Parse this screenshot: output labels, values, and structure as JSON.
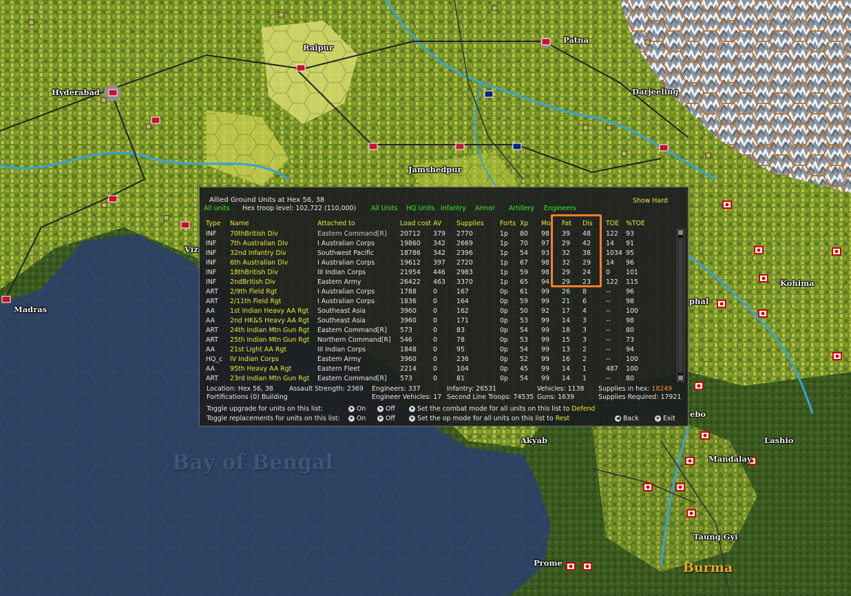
{
  "map": {
    "cities": [
      {
        "name": "Raipur",
        "key": "raipur"
      },
      {
        "name": "Patna",
        "key": "patna"
      },
      {
        "name": "Hyderabad",
        "key": "hyderabad"
      },
      {
        "name": "Darjeeling",
        "key": "darjeeling"
      },
      {
        "name": "Jamshedpur",
        "key": "jamshedpur"
      },
      {
        "name": "Madras",
        "key": "madras"
      },
      {
        "name": "Kohima",
        "key": "kohima"
      },
      {
        "name": "Akyab",
        "key": "akyab"
      },
      {
        "name": "Lashio",
        "key": "lashio"
      },
      {
        "name": "Mandalay",
        "key": "mandalay"
      },
      {
        "name": "Taung Gyi",
        "key": "taunggyi"
      },
      {
        "name": "Prome",
        "key": "prome"
      },
      {
        "name": "Viza",
        "key": "viza"
      },
      {
        "name": "phal",
        "key": "phal"
      },
      {
        "name": "ebo",
        "key": "ebo"
      }
    ],
    "sea_label": "Bay of Bengal",
    "region_label": "Burma"
  },
  "panel": {
    "title": "Allied Ground Units at Hex 56, 38",
    "filter_all": "All units",
    "troop_level": "Hex troop level: 102,722  (110,000)",
    "show_hard": "Show Hard",
    "filters": [
      "All Units",
      "HQ Units",
      "Infantry",
      "Armor",
      "Artillery",
      "Engineers"
    ],
    "headers": {
      "type": "Type",
      "name": "Name",
      "attached": "Attached to",
      "load": "Load cost",
      "av": "AV",
      "supplies": "Supplies",
      "forts": "Forts",
      "xp": "Xp",
      "mo": "Mo",
      "fat": "Fat",
      "dis": "Dis",
      "toe": "TOE",
      "ptoe": "%TOE"
    },
    "rows": [
      {
        "type": "INF",
        "name": "70thBritish Div",
        "attached": "Eastern Command[R]",
        "load": "20712",
        "av": "379",
        "supplies": "2770",
        "forts": "1p",
        "xp": "80",
        "mo": "98",
        "fat": "39",
        "dis": "48",
        "toe": "122",
        "ptoe": "93"
      },
      {
        "type": "INF",
        "name": "7th Australian Div",
        "attached": "I Australian Corps",
        "load": "19860",
        "av": "342",
        "supplies": "2669",
        "forts": "1p",
        "xp": "70",
        "mo": "97",
        "fat": "29",
        "dis": "42",
        "toe": "14",
        "ptoe": "91"
      },
      {
        "type": "INF",
        "name": "32nd Infantry Div",
        "attached": "Southwest Pacific",
        "load": "18786",
        "av": "342",
        "supplies": "2396",
        "forts": "1p",
        "xp": "54",
        "mo": "93",
        "fat": "32",
        "dis": "38",
        "toe": "1034",
        "ptoe": "95"
      },
      {
        "type": "INF",
        "name": "6th Australian Div",
        "attached": "I Australian Corps",
        "load": "19612",
        "av": "397",
        "supplies": "2720",
        "forts": "1p",
        "xp": "67",
        "mo": "98",
        "fat": "32",
        "dis": "29",
        "toe": "14",
        "ptoe": "96"
      },
      {
        "type": "INF",
        "name": "18thBritish Div",
        "attached": "III Indian Corps",
        "load": "21954",
        "av": "446",
        "supplies": "2983",
        "forts": "1p",
        "xp": "59",
        "mo": "98",
        "fat": "29",
        "dis": "24",
        "toe": "0",
        "ptoe": "101"
      },
      {
        "type": "INF",
        "name": "2ndBritish Div",
        "attached": "Eastern Army",
        "load": "26422",
        "av": "463",
        "supplies": "3370",
        "forts": "1p",
        "xp": "65",
        "mo": "94",
        "fat": "29",
        "dis": "23",
        "toe": "122",
        "ptoe": "115"
      },
      {
        "type": "ART",
        "name": "2/9th Field Rgt",
        "attached": "I Australian Corps",
        "load": "1788",
        "av": "0",
        "supplies": "167",
        "forts": "0p",
        "xp": "61",
        "mo": "99",
        "fat": "26",
        "dis": "8",
        "toe": "--",
        "ptoe": "96"
      },
      {
        "type": "ART",
        "name": "2/11th Field Rgt",
        "attached": "I Australian Corps",
        "load": "1836",
        "av": "0",
        "supplies": "164",
        "forts": "0p",
        "xp": "59",
        "mo": "99",
        "fat": "21",
        "dis": "6",
        "toe": "--",
        "ptoe": "98"
      },
      {
        "type": "AA",
        "name": "1st Indian Heavy AA Rgt",
        "attached": "Southeast Asia",
        "load": "3960",
        "av": "0",
        "supplies": "162",
        "forts": "0p",
        "xp": "50",
        "mo": "92",
        "fat": "17",
        "dis": "4",
        "toe": "--",
        "ptoe": "100"
      },
      {
        "type": "AA",
        "name": "2nd HK&S Heavy AA Rgt",
        "attached": "Southeast Asia",
        "load": "3960",
        "av": "0",
        "supplies": "171",
        "forts": "0p",
        "xp": "53",
        "mo": "99",
        "fat": "14",
        "dis": "3",
        "toe": "--",
        "ptoe": "98"
      },
      {
        "type": "ART",
        "name": "24th Indian Mtn Gun Rgt",
        "attached": "Eastern Command[R]",
        "load": "573",
        "av": "0",
        "supplies": "83",
        "forts": "0p",
        "xp": "54",
        "mo": "99",
        "fat": "18",
        "dis": "3",
        "toe": "--",
        "ptoe": "80"
      },
      {
        "type": "ART",
        "name": "25th Indian Mtn Gun Rgt",
        "attached": "Northern Command[R]",
        "load": "546",
        "av": "0",
        "supplies": "78",
        "forts": "0p",
        "xp": "53",
        "mo": "99",
        "fat": "15",
        "dis": "3",
        "toe": "--",
        "ptoe": "73"
      },
      {
        "type": "AA",
        "name": "21st Light AA Rgt",
        "attached": "III Indian Corps",
        "load": "1848",
        "av": "0",
        "supplies": "95",
        "forts": "0p",
        "xp": "54",
        "mo": "99",
        "fat": "13",
        "dis": "2",
        "toe": "--",
        "ptoe": "94"
      },
      {
        "type": "HQ_c",
        "name": "IV Indian Corps",
        "attached": "Eastern Army",
        "load": "3960",
        "av": "0",
        "supplies": "236",
        "forts": "0p",
        "xp": "52",
        "mo": "99",
        "fat": "16",
        "dis": "2",
        "toe": "--",
        "ptoe": "100"
      },
      {
        "type": "AA",
        "name": "95th Heavy AA Rgt",
        "attached": "Eastern Fleet",
        "load": "2214",
        "av": "0",
        "supplies": "104",
        "forts": "0p",
        "xp": "45",
        "mo": "99",
        "fat": "14",
        "dis": "1",
        "toe": "487",
        "ptoe": "100"
      },
      {
        "type": "ART",
        "name": "23rd Indian Mtn Gun Rgt",
        "attached": "Eastern Command[R]",
        "load": "573",
        "av": "0",
        "supplies": "81",
        "forts": "0p",
        "xp": "54",
        "mo": "99",
        "fat": "14",
        "dis": "1",
        "toe": "--",
        "ptoe": "80"
      }
    ],
    "footer": {
      "location": "Location: Hex 56, 38",
      "assault": "Assault Strength: 2369",
      "engineers": "Engineers: 337",
      "infantry": "Infantry: 26531",
      "vehicles": "Vehicles: 1138",
      "supplies_in_hex_label": "Supplies in hex:",
      "supplies_in_hex_value": "18249",
      "fortifications": "Fortifications (0) Building",
      "engineer_vehicles": "Engineer Vehicles:  17",
      "second_line": "Second Line Troops: 74535",
      "guns": "Guns: 1639",
      "supplies_required": "Supplies Required:  17921",
      "toggle_upgrade": "Toggle upgrade for units on this list:",
      "toggle_replacements": "Toggle replacements for units on this list:",
      "on": "On",
      "off": "Off",
      "combat_mode": "Set the combat mode for all units on this list to",
      "combat_mode_value": "Defend",
      "op_mode": "Set the op mode for all units on this list to",
      "op_mode_value": "Rest",
      "back": "Back",
      "exit": "Exit"
    }
  },
  "colors": {
    "highlight": "#ff7f2a",
    "green_text": "#33ee22",
    "yellow_text": "#e8ea36",
    "panel_bg": "#1c1e1f"
  }
}
